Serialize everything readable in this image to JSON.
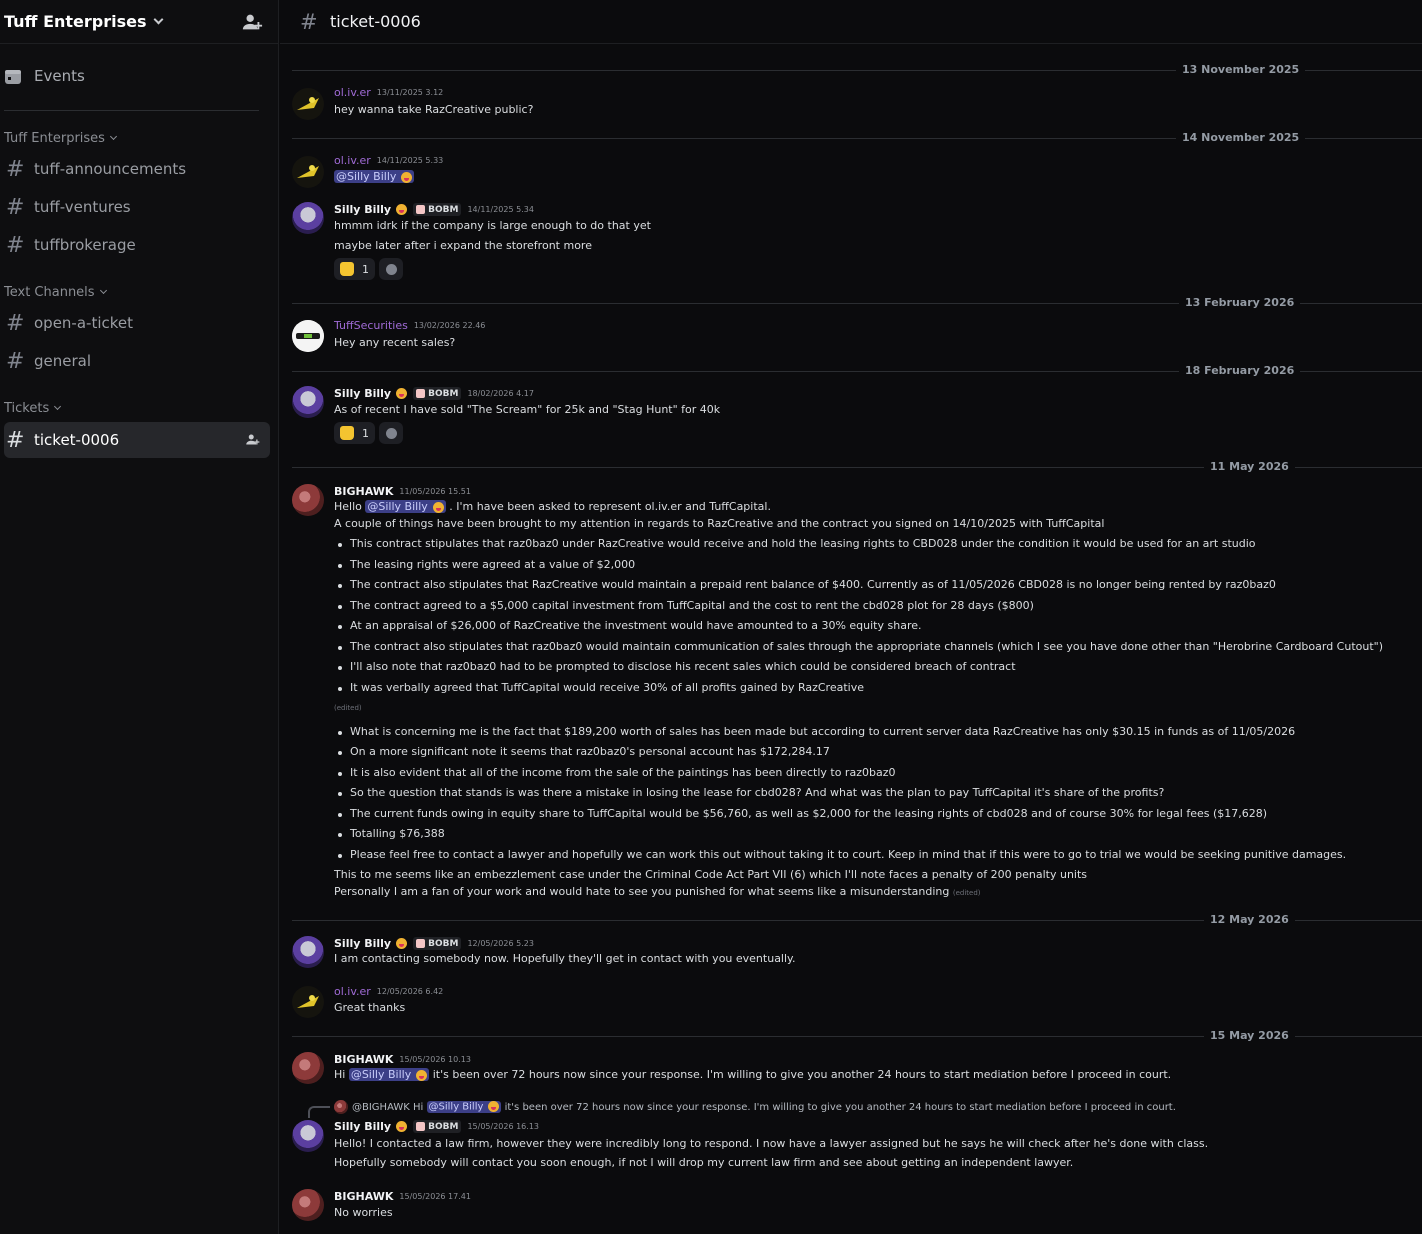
{
  "server": {
    "name": "Tuff Enterprises"
  },
  "sidebar": {
    "events_label": "Events",
    "categories": [
      {
        "label": "Tuff Enterprises",
        "channels": [
          "tuff-announcements",
          "tuff-ventures",
          "tuffbrokerage"
        ]
      },
      {
        "label": "Text Channels",
        "channels": [
          "open-a-ticket",
          "general"
        ]
      },
      {
        "label": "Tickets",
        "channels": [
          "ticket-0006"
        ]
      }
    ]
  },
  "channel": {
    "name": "ticket-0006"
  },
  "colors": {
    "mention_bg": "#3c3f87",
    "username_purple": "#a06bd6",
    "active_channel_bg": "#26272b"
  },
  "dividers": [
    "13 November 2025",
    "14 November 2025",
    "13 February 2026",
    "18 February 2026",
    "11 May 2026",
    "12 May 2026",
    "15 May 2026"
  ],
  "tags": {
    "bobm": "BOBM"
  },
  "messages": {
    "m1": {
      "author": "ol.iv.er",
      "time": "13/11/2025 3.12",
      "text": "hey wanna take RazCreative public?"
    },
    "m2": {
      "author": "ol.iv.er",
      "time": "14/11/2025 5.33",
      "mention": "@Silly Billy"
    },
    "m3": {
      "author": "Silly Billy",
      "time": "14/11/2025 5.34",
      "lines": [
        "hmmm idrk if the company is large enough to do that yet",
        "maybe later after i expand the storefront more"
      ],
      "reaction_count": "1"
    },
    "m4": {
      "author": "TuffSecurities",
      "time": "13/02/2026 22.46",
      "text": "Hey any recent sales?"
    },
    "m5": {
      "author": "Silly Billy",
      "time": "18/02/2026 4.17",
      "text": "As of recent I have sold \"The Scream\" for 25k and \"Stag Hunt\" for 40k",
      "reaction_count": "1"
    },
    "m6": {
      "author": "BIGHAWK",
      "time": "11/05/2026 15.51",
      "hello_prefix": "Hello",
      "mention": "@Silly Billy",
      "hello_suffix": ". I'm have been asked to represent ol.iv.er and TuffCapital.",
      "line2": "A couple of things have been brought to my attention in regards to RazCreative and the contract you signed on 14/10/2025 with TuffCapital",
      "bullets_a": [
        "This contract stipulates that raz0baz0 under RazCreative would receive and hold the leasing rights to CBD028 under the condition it would be used for an art studio",
        "The leasing rights were agreed at a value of $2,000",
        "The contract also stipulates that RazCreative would maintain a prepaid rent balance of $400. Currently as of 11/05/2026 CBD028 is no longer being rented by raz0baz0",
        "The contract agreed to a $5,000 capital investment from TuffCapital and the cost to rent the cbd028 plot for 28 days ($800)",
        "At an appraisal of $26,000 of RazCreative the investment would have amounted to a 30% equity share.",
        "The contract also stipulates that raz0baz0 would maintain communication of sales through the appropriate channels (which I see you have done other than \"Herobrine Cardboard Cutout\")",
        "I'll also note that raz0baz0 had to be prompted to disclose his recent sales which could be considered breach of contract",
        "It was verbally agreed that TuffCapital would receive 30% of all profits gained by RazCreative"
      ],
      "edited": "(edited)",
      "bullets_b": [
        "What is concerning me is the fact that $189,200 worth of sales has been made but according to current server data RazCreative has only $30.15 in funds as of 11/05/2026",
        "On a more significant note it seems that raz0baz0's personal account has $172,284.17",
        "It is also evident that all of the income from the sale of the paintings has been directly to raz0baz0",
        "So the question that stands is was there a mistake in losing the lease for cbd028? And what was the plan to pay TuffCapital it's share of the profits?",
        "The current funds owing in equity share to TuffCapital would be $56,760, as well as $2,000 for the leasing rights of cbd028 and of course 30% for legal fees ($17,628)",
        "Totalling $76,388",
        "Please feel free to contact a lawyer and hopefully we can work this out without taking it to court. Keep in mind that if this were to go to trial we would be seeking punitive damages."
      ],
      "closing1": "This to me seems like an embezzlement case under the Criminal Code Act Part VII (6) which I'll note faces a penalty of 200 penalty units",
      "closing2": "Personally I am a fan of your work and would hate to see you punished for what seems like a misunderstanding"
    },
    "m7": {
      "author": "Silly Billy",
      "time": "12/05/2026 5.23",
      "text": "I am contacting somebody now. Hopefully they'll get in contact with you eventually."
    },
    "m8": {
      "author": "ol.iv.er",
      "time": "12/05/2026 6.42",
      "text": "Great thanks"
    },
    "m9": {
      "author": "BIGHAWK",
      "time": "15/05/2026 10.13",
      "prefix": "Hi",
      "mention": "@Silly Billy",
      "suffix": "it's been over 72 hours now since your response. I'm willing to give you another 24 hours to start mediation before I proceed in court."
    },
    "m10": {
      "reply_author": "@BIGHAWK",
      "reply_prefix": "Hi",
      "reply_mention": "@Silly Billy",
      "reply_suffix": "it's been over 72 hours now since your response. I'm willing to give you another 24 hours to start mediation before I proceed in court.",
      "author": "Silly Billy",
      "time": "15/05/2026 16.13",
      "lines": [
        "Hello! I contacted a law firm, however they were incredibly long to respond. I now have a lawyer assigned but he says he will check after he's done with class.",
        "Hopefully somebody will contact you soon enough, if not I will drop my current law firm and see about getting an independent lawyer."
      ]
    },
    "m11": {
      "author": "BIGHAWK",
      "time": "15/05/2026 17.41",
      "text": "No worries"
    }
  }
}
